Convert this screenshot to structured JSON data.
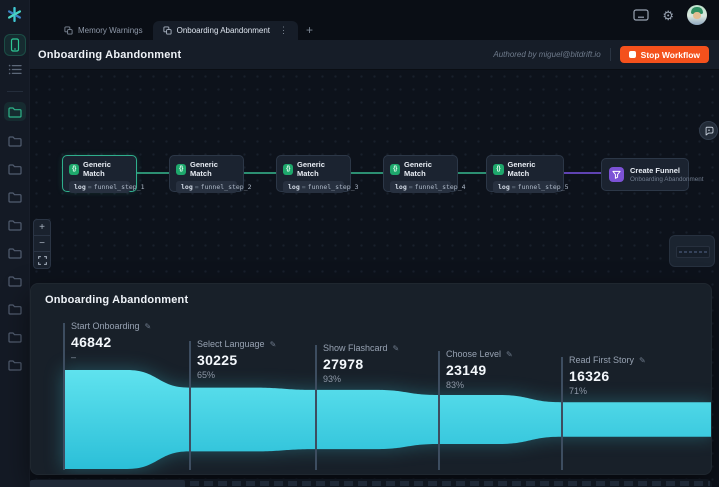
{
  "topbar": {
    "tabs": [
      {
        "label": "Memory Warnings"
      },
      {
        "label": "Onboarding Abandonment"
      }
    ],
    "tab_menu": "⋮",
    "new_tab_label": "+"
  },
  "header": {
    "title": "Onboarding Abandonment",
    "authored_by": "Authored by miguel@bitdrift.io",
    "stop_button_label": "Stop Workflow"
  },
  "workflow": {
    "match_nodes": [
      {
        "title": "Generic Match",
        "key": "log",
        "op": "=",
        "value": "funnel_step_1"
      },
      {
        "title": "Generic Match",
        "key": "log",
        "op": "=",
        "value": "funnel_step_2"
      },
      {
        "title": "Generic Match",
        "key": "log",
        "op": "=",
        "value": "funnel_step_3"
      },
      {
        "title": "Generic Match",
        "key": "log",
        "op": "=",
        "value": "funnel_step_4"
      },
      {
        "title": "Generic Match",
        "key": "log",
        "op": "=",
        "value": "funnel_step_5"
      }
    ],
    "funnel_node": {
      "title": "Create Funnel",
      "subtitle": "Onboarding Abandonment"
    },
    "match_icon_glyph": "{}",
    "zoom_in": "+",
    "zoom_out": "−"
  },
  "funnel_panel": {
    "title": "Onboarding Abandonment",
    "steps": [
      {
        "label": "Start Onboarding",
        "value": "46842",
        "sub": "–"
      },
      {
        "label": "Select Language",
        "value": "30225",
        "sub": "65%"
      },
      {
        "label": "Show Flashcard",
        "value": "27978",
        "sub": "93%"
      },
      {
        "label": "Choose Level",
        "value": "23149",
        "sub": "83%"
      },
      {
        "label": "Read First Story",
        "value": "16326",
        "sub": "71%"
      }
    ]
  },
  "chart_data": {
    "type": "area",
    "subtype": "funnel",
    "title": "Onboarding Abandonment",
    "categories": [
      "Start Onboarding",
      "Select Language",
      "Show Flashcard",
      "Choose Level",
      "Read First Story"
    ],
    "values": [
      46842,
      30225,
      27978,
      23149,
      16326
    ],
    "pct_of_previous": [
      null,
      65,
      93,
      83,
      71
    ],
    "legend": "none",
    "grid": "off",
    "color": "#3fd2e4"
  },
  "colors": {
    "accent_teal": "#2eb489",
    "accent_cyan": "#3fd2e4",
    "stop_button": "#f4511c",
    "edge_green": "#2c8f72",
    "edge_purple": "#5f43b2",
    "node_icon_green": "#1ea86c",
    "node_icon_purple": "#7c52d6"
  }
}
